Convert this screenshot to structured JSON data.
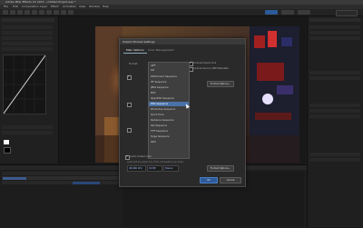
{
  "app": {
    "title": "Adobe After Effects CC 2015 - Untitled Project.aep *"
  },
  "menu": {
    "items": [
      "File",
      "Edit",
      "Composition",
      "Layer",
      "Effect",
      "Animation",
      "View",
      "Window",
      "Help"
    ]
  },
  "dialog": {
    "title": "Output Module Settings",
    "tabs": [
      "Main Options",
      "Color Management"
    ],
    "format_label": "Format:",
    "format_options": [
      "AIFF",
      "AVI",
      "DPX/Cineon Sequence",
      "IFF Sequence",
      "JPEG Sequence",
      "MP3",
      "OpenEXR Sequence",
      "PNG Sequence",
      "Photoshop Sequence",
      "Quick Time",
      "Radiance Sequence",
      "SGI Sequence",
      "TIFF Sequence",
      "Targa Sequence",
      "WAV"
    ],
    "selected_format": "PNG Sequence",
    "include_project_link": "Include Project Link",
    "include_source_xmp": "Include Source XMP Metadata",
    "format_options_button": "Format Options...",
    "audio_section": "Audio Output",
    "audio_auto": "Audio Output Auto",
    "audio_note": "Audio will be output only if the composition has audio.",
    "audio_rate": "48.000 kHz",
    "audio_bits": "16 Bit",
    "audio_channels": "Stereo",
    "audio_format_options_button": "Format Options...",
    "ok_button": "OK",
    "cancel_button": "Cancel"
  },
  "colors": {
    "accent": "#4a72a8",
    "panel": "#202020",
    "dialog": "#2a2a2a"
  }
}
